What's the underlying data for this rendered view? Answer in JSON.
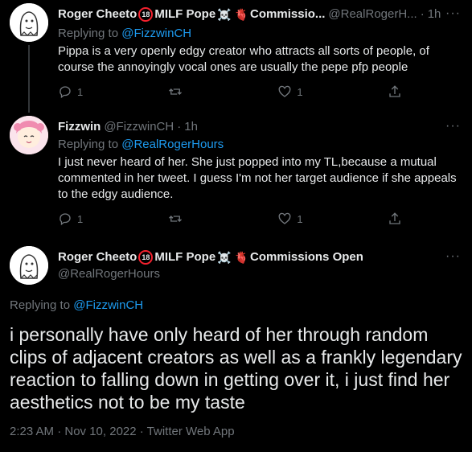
{
  "tweets": [
    {
      "name": "Roger Cheeto",
      "badge": "18",
      "name_suffix": "MILF Pope",
      "emojis": [
        "☠️",
        "🫀"
      ],
      "name_tail": "Commissio...",
      "handle": "@RealRogerH...",
      "time": "1h",
      "replying_label": "Replying to",
      "replying_to": "@FizzwinCH",
      "text": "Pippa is a very openly edgy creator who attracts all sorts of people, of course the annoyingly vocal ones are usually the pepe pfp people",
      "reply_count": "1",
      "retweet_count": "",
      "like_count": "1"
    },
    {
      "name": "Fizzwin",
      "handle": "@FizzwinCH",
      "time": "1h",
      "replying_label": "Replying to",
      "replying_to": "@RealRogerHours",
      "text": "I just never heard of her. She just popped into my TL,because a mutual commented in her tweet. I guess I'm not her target audience if she appeals to the edgy audience.",
      "reply_count": "1",
      "retweet_count": "",
      "like_count": "1"
    }
  ],
  "main_tweet": {
    "name": "Roger Cheeto",
    "badge": "18",
    "name_suffix": "MILF Pope",
    "emojis": [
      "☠️",
      "🫀"
    ],
    "name_tail": "Commissions Open",
    "handle": "@RealRogerHours",
    "replying_label": "Replying to",
    "replying_to": "@FizzwinCH",
    "text": "i personally have only heard of her through random clips of adjacent creators as well as a frankly legendary reaction to falling down in getting over it, i just find her aesthetics not to be my taste",
    "timestamp": "2:23 AM · Nov 10, 2022 · Twitter Web App"
  },
  "ui": {
    "dot": "·",
    "more": "···"
  },
  "colors": {
    "background": "#000000",
    "text": "#e7e9ea",
    "muted": "#71767b",
    "link": "#1d9bf0",
    "thread_line": "#333639"
  }
}
